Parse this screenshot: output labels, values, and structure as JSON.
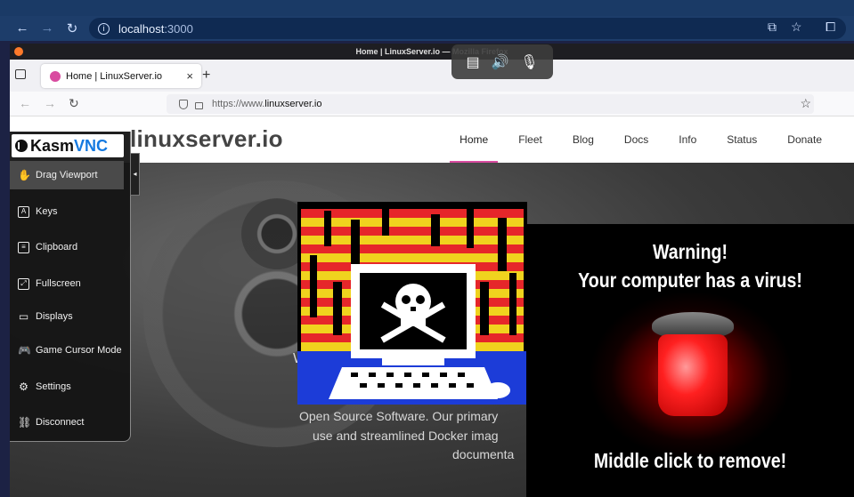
{
  "host_browser": {
    "url_host": "localhost",
    "url_port": ":3000"
  },
  "remote_window": {
    "title": "Home | LinuxServer.io — Mozilla Firefox",
    "tab_title": "Home | LinuxServer.io",
    "url_scheme": "https://www.",
    "url_host": "linuxserver.io"
  },
  "site": {
    "logo": "linuxserver.io",
    "nav": [
      "Home",
      "Fleet",
      "Blog",
      "Docs",
      "Info",
      "Status",
      "Donate"
    ],
    "hero_lines": [
      "Open Source Software. Our primary",
      "use and streamlined Docker imag",
      "documenta"
    ],
    "hero_partial": "W"
  },
  "kasm": {
    "logo_kasm": "Kasm",
    "logo_vnc": "VNC",
    "items": [
      {
        "label": "Drag Viewport",
        "icon": "hand-icon"
      },
      {
        "label": "Keys",
        "icon": "keys-icon"
      },
      {
        "label": "Clipboard",
        "icon": "clipboard-icon"
      },
      {
        "label": "Fullscreen",
        "icon": "fullscreen-icon"
      },
      {
        "label": "Displays",
        "icon": "display-icon"
      },
      {
        "label": "Game Cursor Mode",
        "icon": "gamepad-icon"
      },
      {
        "label": "Settings",
        "icon": "gear-icon"
      },
      {
        "label": "Disconnect",
        "icon": "disconnect-icon"
      }
    ]
  },
  "warning": {
    "title": "Warning!",
    "subtitle": "Your computer has a virus!",
    "action": "Middle click to remove!"
  }
}
